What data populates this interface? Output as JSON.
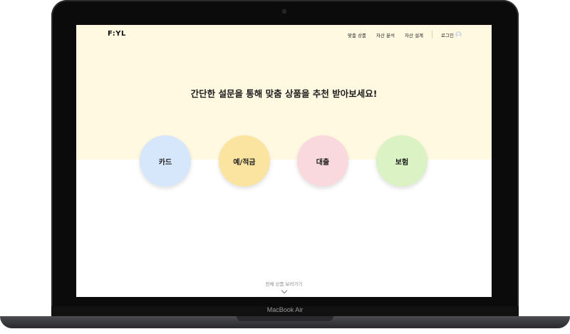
{
  "device": {
    "model_label": "MacBook Air"
  },
  "nav": {
    "logo": "F:YL",
    "links": [
      "맞춤 상품",
      "자산 분석",
      "자산 설계"
    ],
    "login": "로그인"
  },
  "hero": {
    "headline": "간단한 설문을 통해 맞춤 상품을 추천 받아보세요!",
    "background_color": "#fff9e1"
  },
  "categories": [
    {
      "label": "카드",
      "color": "#d6e7fb"
    },
    {
      "label": "예/적금",
      "color": "#fbe3a0"
    },
    {
      "label": "대출",
      "color": "#f9d9dd"
    },
    {
      "label": "보험",
      "color": "#daf2c4"
    }
  ],
  "footer": {
    "view_all": "전체 상품 보러가기"
  }
}
